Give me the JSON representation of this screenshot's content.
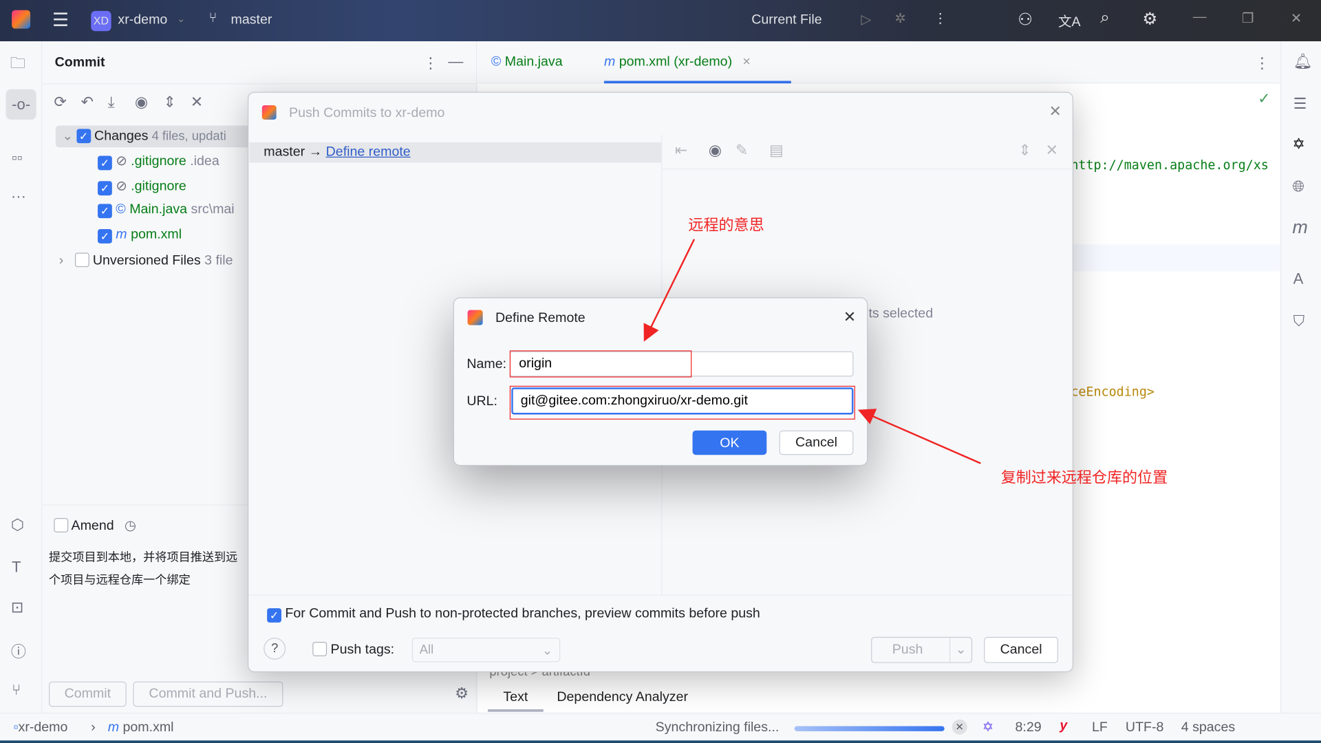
{
  "titlebar": {
    "project_badge": "XD",
    "project": "xr-demo",
    "branch": "master",
    "run_config": "Current File"
  },
  "commit_panel": {
    "title": "Commit",
    "changes_label": "Changes",
    "changes_info": "4 files, updati",
    "files": [
      {
        "name": ".gitignore",
        "path": ".idea",
        "icon": "ignored-icon"
      },
      {
        "name": ".gitignore",
        "path": "",
        "icon": "ignored-icon"
      },
      {
        "name": "Main.java",
        "path": "src\\mai",
        "icon": "class-icon"
      },
      {
        "name": "pom.xml",
        "path": "",
        "icon": "maven-icon"
      }
    ],
    "unversioned_label": "Unversioned Files",
    "unversioned_info": "3 file",
    "amend": "Amend",
    "message_line1": "提交项目到本地，并将项目推送到远",
    "message_line2": "个项目与远程仓库一个绑定",
    "commit_btn": "Commit",
    "commit_push_btn": "Commit and Push..."
  },
  "editor": {
    "tabs": [
      {
        "label": "Main.java",
        "icon": "class-icon"
      },
      {
        "label": "pom.xml (xr-demo)",
        "icon": "maven-icon"
      }
    ],
    "line_url": "http://maven.apache.org/xs",
    "line_encoding": "ceEncoding>",
    "bottom_tabs": [
      "Text",
      "Dependency Analyzer"
    ],
    "crumb": "project > artifactId"
  },
  "push_dialog": {
    "title": "Push Commits to xr-demo",
    "branch": "master",
    "arrow": "→",
    "define_remote": "Define remote",
    "no_selection": "ts selected",
    "preview_option": "For Commit and Push to non-protected branches, preview commits before push",
    "push_tags": "Push tags:",
    "tags_value": "All",
    "push_btn": "Push",
    "cancel_btn": "Cancel"
  },
  "define_remote": {
    "title": "Define Remote",
    "name_label": "Name:",
    "name_value": "origin",
    "url_label": "URL:",
    "url_value": "git@gitee.com:zhongxiruo/xr-demo.git",
    "ok": "OK",
    "cancel": "Cancel"
  },
  "annotations": {
    "top": "远程的意思",
    "right": "复制过来远程仓库的位置",
    "color": "#f02424"
  },
  "statusbar": {
    "project": "xr-demo",
    "file": "pom.xml",
    "sync": "Synchronizing files...",
    "progress_percent": 100,
    "position": "8:29",
    "line_sep": "LF",
    "encoding": "UTF-8",
    "indent": "4 spaces"
  },
  "colors": {
    "accent": "#3574f0",
    "title_bg": "#2b3040"
  }
}
